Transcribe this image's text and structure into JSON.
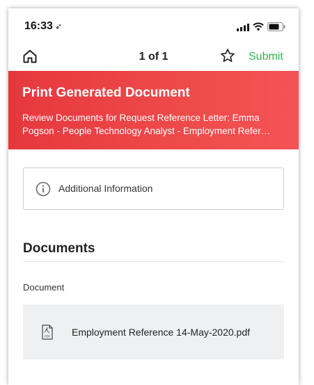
{
  "status_bar": {
    "time": "16:33",
    "location_glyph": "➶"
  },
  "nav": {
    "home_icon": "home-icon",
    "page_count": "1 of 1",
    "star_icon": "star-icon",
    "submit_label": "Submit"
  },
  "header": {
    "title": "Print Generated Document",
    "subtitle": "Review Documents for Request Reference Letter: Emma Pogson - People Technology Analyst - Employment Refer…"
  },
  "info_card": {
    "icon": "info-icon",
    "label": "Additional Information"
  },
  "documents": {
    "section_title": "Documents",
    "field_label": "Document",
    "items": [
      {
        "icon": "pdf-icon",
        "name": "Employment Reference 14-May-2020.pdf"
      }
    ]
  },
  "colors": {
    "header_red": "#ef4a4a",
    "submit_green": "#2fb84a",
    "doc_row_bg": "#eef0f1"
  }
}
